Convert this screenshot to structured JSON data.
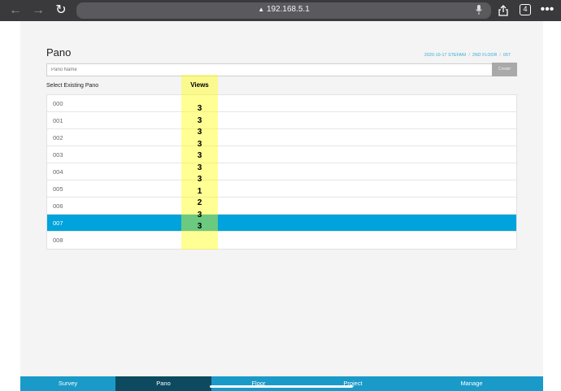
{
  "browser": {
    "url": "192.168.5.1",
    "tab_count": "4"
  },
  "page": {
    "title": "Pano",
    "breadcrumb": [
      "2020-10-17 STEFANI",
      "2ND FLOOR",
      "007"
    ],
    "name_input_placeholder": "Pano Name",
    "create_label": "Create",
    "select_label": "Select Existing Pano",
    "views_header": "Views",
    "panos": [
      {
        "name": "000",
        "selected": false
      },
      {
        "name": "001",
        "selected": false
      },
      {
        "name": "002",
        "selected": false
      },
      {
        "name": "003",
        "selected": false
      },
      {
        "name": "004",
        "selected": false
      },
      {
        "name": "005",
        "selected": false
      },
      {
        "name": "006",
        "selected": false
      },
      {
        "name": "007",
        "selected": true
      },
      {
        "name": "008",
        "selected": false
      }
    ],
    "views": [
      "3",
      "3",
      "3",
      "3",
      "3",
      "3",
      "3",
      "1",
      "2",
      "3",
      "3"
    ]
  },
  "bottom_nav": {
    "items": [
      {
        "label": "Survey",
        "active": false
      },
      {
        "label": "Pano",
        "active": true
      },
      {
        "label": "Floor",
        "active": false
      },
      {
        "label": "Project",
        "active": false
      },
      {
        "label": "Manage",
        "active": false
      }
    ]
  },
  "colors": {
    "accent": "#00a3dc",
    "nav_bg": "#1a9ac8",
    "nav_active": "#0d4a60",
    "highlight": "#ffff00"
  }
}
